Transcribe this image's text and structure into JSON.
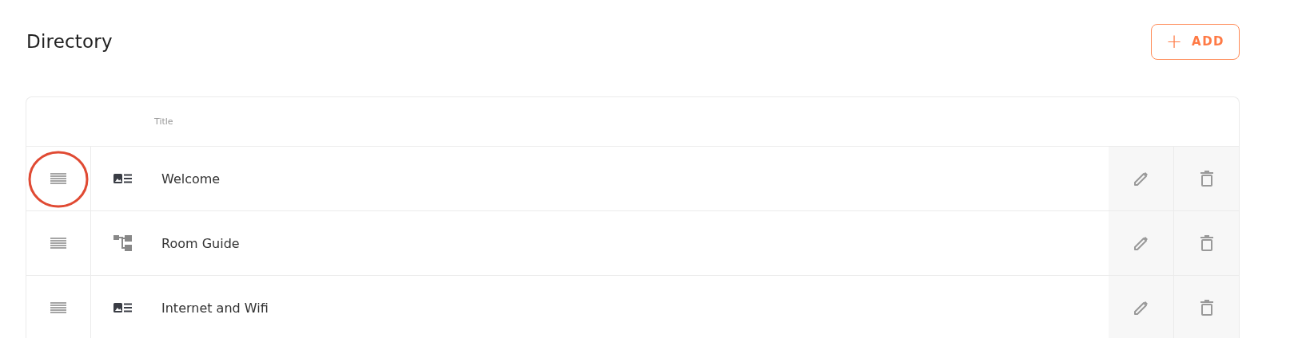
{
  "header": {
    "title": "Directory",
    "add_button": {
      "icon": "+",
      "label": "ADD"
    }
  },
  "table": {
    "columns": [
      "Title"
    ],
    "rows": [
      {
        "kind": "page",
        "title": "Welcome",
        "highlighted": true
      },
      {
        "kind": "group",
        "title": "Room Guide",
        "highlighted": false
      },
      {
        "kind": "page",
        "title": "Internet and Wifi",
        "highlighted": false
      }
    ]
  }
}
